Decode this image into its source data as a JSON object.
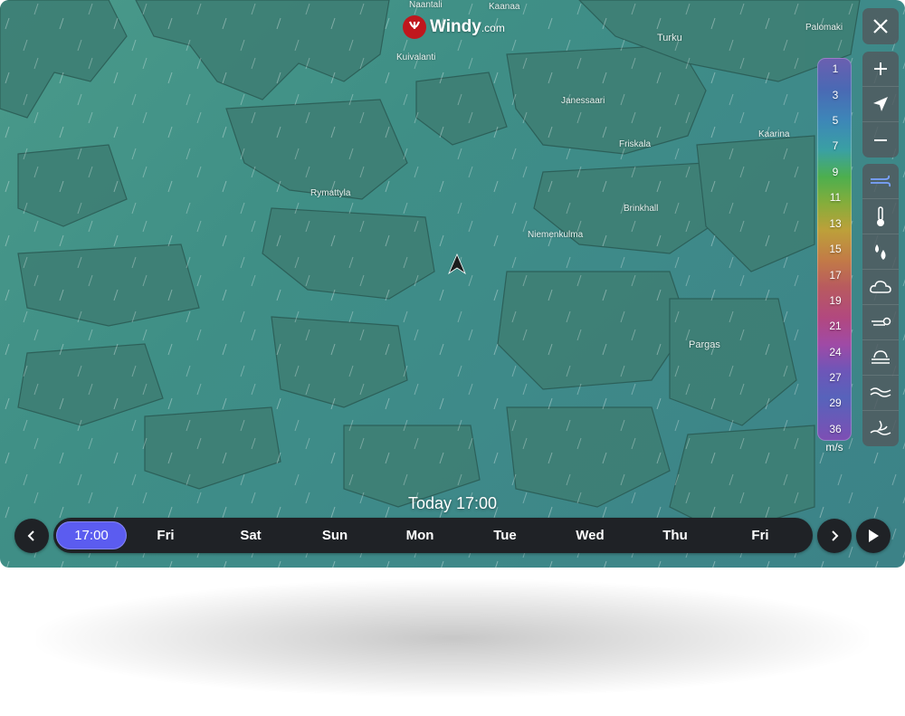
{
  "logo": {
    "brand": "Windy",
    "suffix": ".com"
  },
  "places": [
    "Naantali",
    "Kaanaa",
    "Turku",
    "Palomaki",
    "Kuivalanti",
    "Janessaari",
    "Friskala",
    "Kaarina",
    "Rymattyla",
    "Brinkhall",
    "Niemenkulma",
    "Pargas"
  ],
  "legend": {
    "values": [
      "1",
      "3",
      "5",
      "7",
      "9",
      "11",
      "13",
      "15",
      "17",
      "19",
      "21",
      "24",
      "27",
      "29",
      "36"
    ],
    "unit": "m/s"
  },
  "controls": {
    "close": "close-icon",
    "zoom_in": "plus-icon",
    "locate": "location-arrow-icon",
    "zoom_out": "minus-icon"
  },
  "layers": [
    "wind-icon",
    "thermometer-icon",
    "rain-icon",
    "cloud-icon",
    "wind-gust-icon",
    "fog-icon",
    "waves-icon",
    "swell-icon"
  ],
  "current_time": "Today 17:00",
  "timeline": {
    "days": [
      "17:00",
      "Fri",
      "Sat",
      "Sun",
      "Mon",
      "Tue",
      "Wed",
      "Thu",
      "Fri"
    ],
    "selected_index": 0
  },
  "colors": {
    "accent": "#5b5cf0",
    "brand_red": "#c0171d"
  }
}
